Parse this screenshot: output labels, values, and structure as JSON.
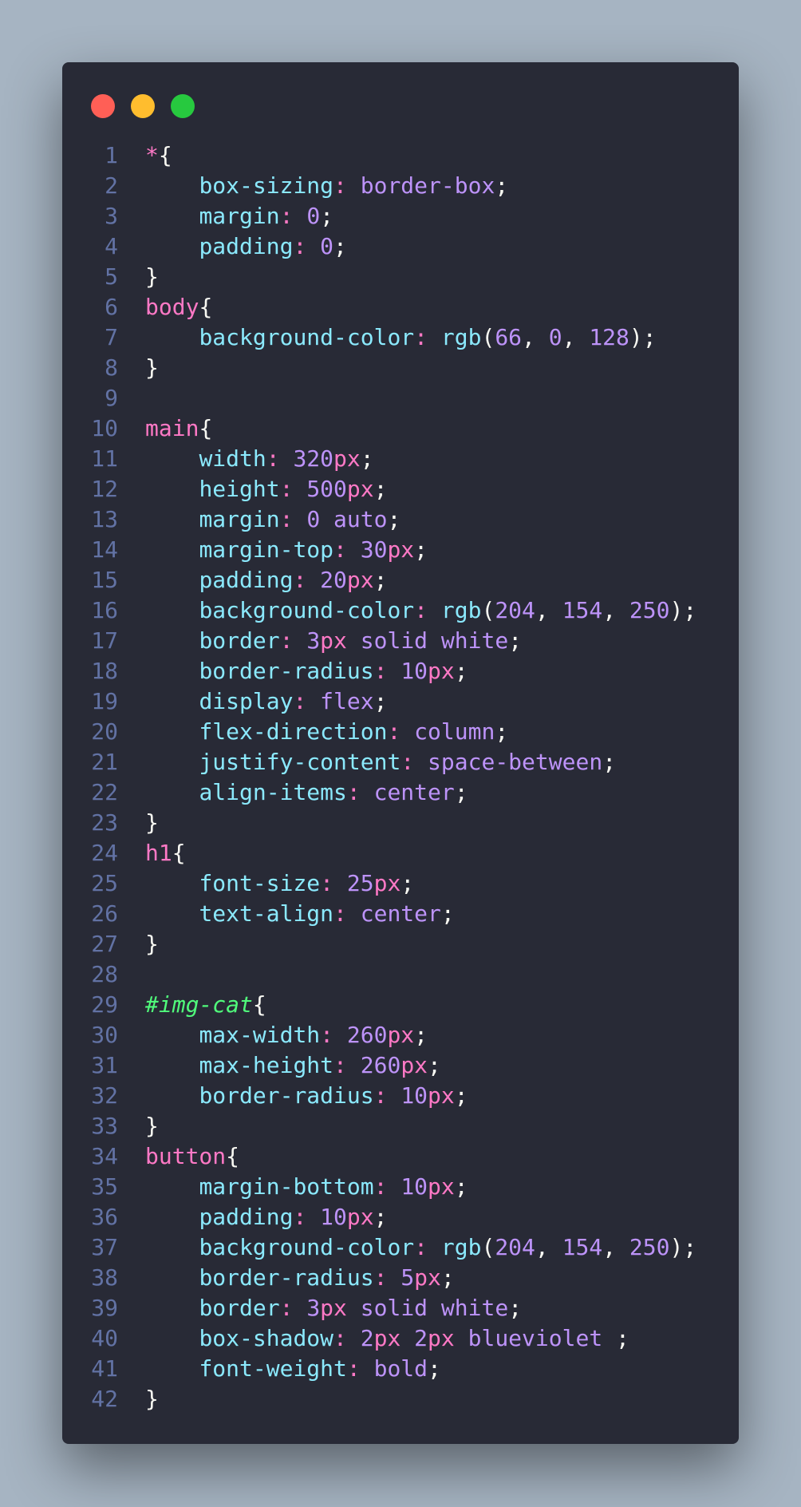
{
  "window": {
    "controls": [
      {
        "name": "close",
        "color": "#ff5f56"
      },
      {
        "name": "minimize",
        "color": "#ffbd2e"
      },
      {
        "name": "maximize",
        "color": "#27c93f"
      }
    ]
  },
  "code": {
    "language": "css",
    "lines": [
      [
        [
          "tag",
          "*"
        ],
        [
          "punc",
          "{"
        ]
      ],
      [
        [
          "ind",
          "    "
        ],
        [
          "prop",
          "box-sizing"
        ],
        [
          "colon",
          ":"
        ],
        [
          "punc",
          " "
        ],
        [
          "val",
          "border-box"
        ],
        [
          "punc",
          ";"
        ]
      ],
      [
        [
          "ind",
          "    "
        ],
        [
          "prop",
          "margin"
        ],
        [
          "colon",
          ":"
        ],
        [
          "punc",
          " "
        ],
        [
          "num",
          "0"
        ],
        [
          "punc",
          ";"
        ]
      ],
      [
        [
          "ind",
          "    "
        ],
        [
          "prop",
          "padding"
        ],
        [
          "colon",
          ":"
        ],
        [
          "punc",
          " "
        ],
        [
          "num",
          "0"
        ],
        [
          "punc",
          ";"
        ]
      ],
      [
        [
          "punc",
          "}"
        ]
      ],
      [
        [
          "tag",
          "body"
        ],
        [
          "punc",
          "{"
        ]
      ],
      [
        [
          "ind",
          "    "
        ],
        [
          "prop",
          "background-color"
        ],
        [
          "colon",
          ":"
        ],
        [
          "punc",
          " "
        ],
        [
          "fn",
          "rgb"
        ],
        [
          "punc",
          "("
        ],
        [
          "num",
          "66"
        ],
        [
          "punc",
          ", "
        ],
        [
          "num",
          "0"
        ],
        [
          "punc",
          ", "
        ],
        [
          "num",
          "128"
        ],
        [
          "punc",
          ");"
        ]
      ],
      [
        [
          "punc",
          "}"
        ]
      ],
      [],
      [
        [
          "tag",
          "main"
        ],
        [
          "punc",
          "{"
        ]
      ],
      [
        [
          "ind",
          "    "
        ],
        [
          "prop",
          "width"
        ],
        [
          "colon",
          ":"
        ],
        [
          "punc",
          " "
        ],
        [
          "num",
          "320"
        ],
        [
          "unit",
          "px"
        ],
        [
          "punc",
          ";"
        ]
      ],
      [
        [
          "ind",
          "    "
        ],
        [
          "prop",
          "height"
        ],
        [
          "colon",
          ":"
        ],
        [
          "punc",
          " "
        ],
        [
          "num",
          "500"
        ],
        [
          "unit",
          "px"
        ],
        [
          "punc",
          ";"
        ]
      ],
      [
        [
          "ind",
          "    "
        ],
        [
          "prop",
          "margin"
        ],
        [
          "colon",
          ":"
        ],
        [
          "punc",
          " "
        ],
        [
          "num",
          "0"
        ],
        [
          "punc",
          " "
        ],
        [
          "val",
          "auto"
        ],
        [
          "punc",
          ";"
        ]
      ],
      [
        [
          "ind",
          "    "
        ],
        [
          "prop",
          "margin-top"
        ],
        [
          "colon",
          ":"
        ],
        [
          "punc",
          " "
        ],
        [
          "num",
          "30"
        ],
        [
          "unit",
          "px"
        ],
        [
          "punc",
          ";"
        ]
      ],
      [
        [
          "ind",
          "    "
        ],
        [
          "prop",
          "padding"
        ],
        [
          "colon",
          ":"
        ],
        [
          "punc",
          " "
        ],
        [
          "num",
          "20"
        ],
        [
          "unit",
          "px"
        ],
        [
          "punc",
          ";"
        ]
      ],
      [
        [
          "ind",
          "    "
        ],
        [
          "prop",
          "background-color"
        ],
        [
          "colon",
          ":"
        ],
        [
          "punc",
          " "
        ],
        [
          "fn",
          "rgb"
        ],
        [
          "punc",
          "("
        ],
        [
          "num",
          "204"
        ],
        [
          "punc",
          ", "
        ],
        [
          "num",
          "154"
        ],
        [
          "punc",
          ", "
        ],
        [
          "num",
          "250"
        ],
        [
          "punc",
          ");"
        ]
      ],
      [
        [
          "ind",
          "    "
        ],
        [
          "prop",
          "border"
        ],
        [
          "colon",
          ":"
        ],
        [
          "punc",
          " "
        ],
        [
          "num",
          "3"
        ],
        [
          "unit",
          "px"
        ],
        [
          "punc",
          " "
        ],
        [
          "val",
          "solid"
        ],
        [
          "punc",
          " "
        ],
        [
          "val",
          "white"
        ],
        [
          "punc",
          ";"
        ]
      ],
      [
        [
          "ind",
          "    "
        ],
        [
          "prop",
          "border-radius"
        ],
        [
          "colon",
          ":"
        ],
        [
          "punc",
          " "
        ],
        [
          "num",
          "10"
        ],
        [
          "unit",
          "px"
        ],
        [
          "punc",
          ";"
        ]
      ],
      [
        [
          "ind",
          "    "
        ],
        [
          "prop",
          "display"
        ],
        [
          "colon",
          ":"
        ],
        [
          "punc",
          " "
        ],
        [
          "val",
          "flex"
        ],
        [
          "punc",
          ";"
        ]
      ],
      [
        [
          "ind",
          "    "
        ],
        [
          "prop",
          "flex-direction"
        ],
        [
          "colon",
          ":"
        ],
        [
          "punc",
          " "
        ],
        [
          "val",
          "column"
        ],
        [
          "punc",
          ";"
        ]
      ],
      [
        [
          "ind",
          "    "
        ],
        [
          "prop",
          "justify-content"
        ],
        [
          "colon",
          ":"
        ],
        [
          "punc",
          " "
        ],
        [
          "val",
          "space-between"
        ],
        [
          "punc",
          ";"
        ]
      ],
      [
        [
          "ind",
          "    "
        ],
        [
          "prop",
          "align-items"
        ],
        [
          "colon",
          ":"
        ],
        [
          "punc",
          " "
        ],
        [
          "val",
          "center"
        ],
        [
          "punc",
          ";"
        ]
      ],
      [
        [
          "punc",
          "}"
        ]
      ],
      [
        [
          "tag",
          "h1"
        ],
        [
          "punc",
          "{"
        ]
      ],
      [
        [
          "ind",
          "    "
        ],
        [
          "prop",
          "font-size"
        ],
        [
          "colon",
          ":"
        ],
        [
          "punc",
          " "
        ],
        [
          "num",
          "25"
        ],
        [
          "unit",
          "px"
        ],
        [
          "punc",
          ";"
        ]
      ],
      [
        [
          "ind",
          "    "
        ],
        [
          "prop",
          "text-align"
        ],
        [
          "colon",
          ":"
        ],
        [
          "punc",
          " "
        ],
        [
          "val",
          "center"
        ],
        [
          "punc",
          ";"
        ]
      ],
      [
        [
          "punc",
          "}"
        ]
      ],
      [],
      [
        [
          "id",
          "#img-cat"
        ],
        [
          "punc",
          "{"
        ]
      ],
      [
        [
          "ind",
          "    "
        ],
        [
          "prop",
          "max-width"
        ],
        [
          "colon",
          ":"
        ],
        [
          "punc",
          " "
        ],
        [
          "num",
          "260"
        ],
        [
          "unit",
          "px"
        ],
        [
          "punc",
          ";"
        ]
      ],
      [
        [
          "ind",
          "    "
        ],
        [
          "prop",
          "max-height"
        ],
        [
          "colon",
          ":"
        ],
        [
          "punc",
          " "
        ],
        [
          "num",
          "260"
        ],
        [
          "unit",
          "px"
        ],
        [
          "punc",
          ";"
        ]
      ],
      [
        [
          "ind",
          "    "
        ],
        [
          "prop",
          "border-radius"
        ],
        [
          "colon",
          ":"
        ],
        [
          "punc",
          " "
        ],
        [
          "num",
          "10"
        ],
        [
          "unit",
          "px"
        ],
        [
          "punc",
          ";"
        ]
      ],
      [
        [
          "punc",
          "}"
        ]
      ],
      [
        [
          "tag",
          "button"
        ],
        [
          "punc",
          "{"
        ]
      ],
      [
        [
          "ind",
          "    "
        ],
        [
          "prop",
          "margin-bottom"
        ],
        [
          "colon",
          ":"
        ],
        [
          "punc",
          " "
        ],
        [
          "num",
          "10"
        ],
        [
          "unit",
          "px"
        ],
        [
          "punc",
          ";"
        ]
      ],
      [
        [
          "ind",
          "    "
        ],
        [
          "prop",
          "padding"
        ],
        [
          "colon",
          ":"
        ],
        [
          "punc",
          " "
        ],
        [
          "num",
          "10"
        ],
        [
          "unit",
          "px"
        ],
        [
          "punc",
          ";"
        ]
      ],
      [
        [
          "ind",
          "    "
        ],
        [
          "prop",
          "background-color"
        ],
        [
          "colon",
          ":"
        ],
        [
          "punc",
          " "
        ],
        [
          "fn",
          "rgb"
        ],
        [
          "punc",
          "("
        ],
        [
          "num",
          "204"
        ],
        [
          "punc",
          ", "
        ],
        [
          "num",
          "154"
        ],
        [
          "punc",
          ", "
        ],
        [
          "num",
          "250"
        ],
        [
          "punc",
          ");"
        ]
      ],
      [
        [
          "ind",
          "    "
        ],
        [
          "prop",
          "border-radius"
        ],
        [
          "colon",
          ":"
        ],
        [
          "punc",
          " "
        ],
        [
          "num",
          "5"
        ],
        [
          "unit",
          "px"
        ],
        [
          "punc",
          ";"
        ]
      ],
      [
        [
          "ind",
          "    "
        ],
        [
          "prop",
          "border"
        ],
        [
          "colon",
          ":"
        ],
        [
          "punc",
          " "
        ],
        [
          "num",
          "3"
        ],
        [
          "unit",
          "px"
        ],
        [
          "punc",
          " "
        ],
        [
          "val",
          "solid"
        ],
        [
          "punc",
          " "
        ],
        [
          "val",
          "white"
        ],
        [
          "punc",
          ";"
        ]
      ],
      [
        [
          "ind",
          "    "
        ],
        [
          "prop",
          "box-shadow"
        ],
        [
          "colon",
          ":"
        ],
        [
          "punc",
          " "
        ],
        [
          "num",
          "2"
        ],
        [
          "unit",
          "px"
        ],
        [
          "punc",
          " "
        ],
        [
          "num",
          "2"
        ],
        [
          "unit",
          "px"
        ],
        [
          "punc",
          " "
        ],
        [
          "val",
          "blueviolet"
        ],
        [
          "punc",
          " ;"
        ]
      ],
      [
        [
          "ind",
          "    "
        ],
        [
          "prop",
          "font-weight"
        ],
        [
          "colon",
          ":"
        ],
        [
          "punc",
          " "
        ],
        [
          "val",
          "bold"
        ],
        [
          "punc",
          ";"
        ]
      ],
      [
        [
          "punc",
          "}"
        ]
      ]
    ]
  }
}
